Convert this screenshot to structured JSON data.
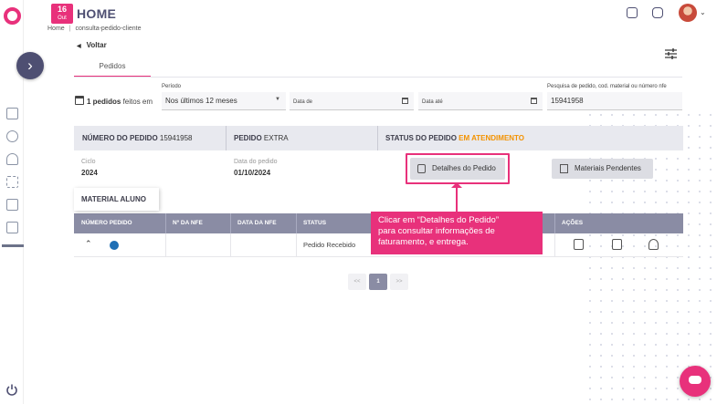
{
  "header": {
    "date_day": "16",
    "date_month": "Out",
    "title": "HOME",
    "breadcrumb": [
      "Home",
      "consulta-pedido-cliente"
    ]
  },
  "nav": {
    "back_label": "Voltar",
    "tab_label": "Pedidos"
  },
  "summary": {
    "count_bold": "1 pedidos",
    "count_rest": "feitos em"
  },
  "filters": {
    "periodo_label": "Período",
    "periodo_value": "Nos últimos 12 meses",
    "data_de": "Data de",
    "data_ate": "Data até",
    "search_label": "Pesquisa de pedido, cod. material ou número nfe",
    "search_value": "15941958"
  },
  "order": {
    "numero_label": "NÚMERO DO PEDIDO",
    "numero_value": "15941958",
    "pedido_label": "PEDIDO",
    "pedido_value": "EXTRA",
    "status_label": "STATUS DO PEDIDO",
    "status_value": "EM ATENDIMENTO",
    "status_color": "#f39200",
    "ciclo_label": "Ciclo",
    "ciclo_value": "2024",
    "data_label": "Data do pedido",
    "data_value": "01/10/2024",
    "detalhes_button": "Detalhes do Pedido",
    "materiais_button": "Materiais Pendentes"
  },
  "material_tab": "MATERIAL ALUNO",
  "table": {
    "headers": [
      "NÚMERO PEDIDO",
      "Nº DA NFE",
      "DATA DA NFE",
      "STATUS",
      "AÇÕES"
    ],
    "rows": [
      {
        "status": "Pedido Recebido"
      }
    ]
  },
  "callout": {
    "line1": "Clicar em “Detalhes do Pedido”",
    "line2": "para consultar informações de",
    "line3": "faturamento, e entrega."
  },
  "pagination": {
    "prev": "<<",
    "current": "1",
    "next": ">>"
  },
  "colors": {
    "accent": "#e8317b",
    "primary": "#4e4f72",
    "table_header": "#8a8ca4"
  }
}
